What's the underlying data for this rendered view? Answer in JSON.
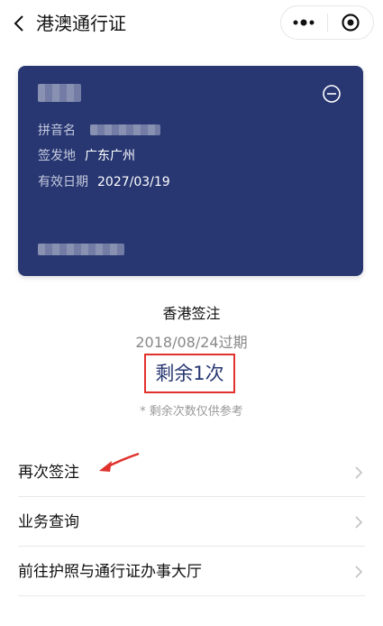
{
  "header": {
    "title": "港澳通行证",
    "back_icon": "chevron-left-icon",
    "more_icon": "more-dots-icon",
    "close_icon": "target-circle-icon"
  },
  "card": {
    "bg_color": "#283772",
    "rows": [
      {
        "label": "拼音名",
        "value": ""
      },
      {
        "label": "签发地",
        "value": "广东广州"
      },
      {
        "label": "有效日期",
        "value": "2027/03/19"
      }
    ],
    "remove_icon": "minus-circle-icon"
  },
  "visa": {
    "type": "香港签注",
    "expiry": "2018/08/24过期",
    "remaining": "剩余1次",
    "note": "* 剩余次数仅供参考",
    "highlight_color": "#e0312d"
  },
  "menu": [
    {
      "label": "再次签注"
    },
    {
      "label": "业务查询"
    },
    {
      "label": "前往护照与通行证办事大厅"
    }
  ],
  "annotation_color": "#e0312d"
}
